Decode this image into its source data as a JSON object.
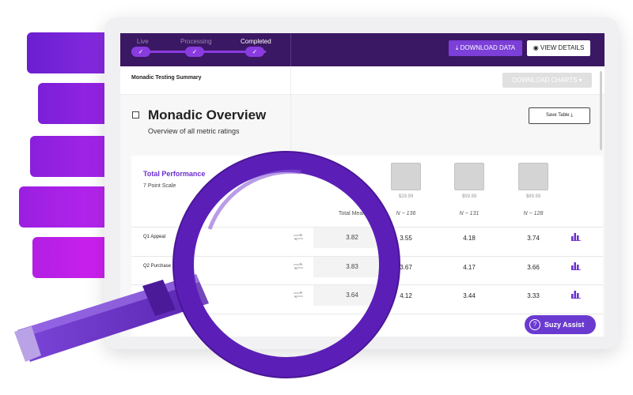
{
  "steps": [
    {
      "label": "Live",
      "done": false
    },
    {
      "label": "Processing",
      "done": false
    },
    {
      "label": "Completed",
      "done": true
    }
  ],
  "header": {
    "download_data": "DOWNLOAD DATA",
    "view_details": "VIEW DETAILS"
  },
  "subheader": {
    "title": "Monadic Testing Summary",
    "download_charts": "DOWNLOAD CHARTS"
  },
  "overview": {
    "title": "Monadic Overview",
    "subtitle": "Overview of all metric ratings",
    "save_table": "Save Table"
  },
  "performance": {
    "title": "Total Performance",
    "scale": "7 Point Scale",
    "total_mean_label": "Total Mean"
  },
  "products": [
    {
      "price": "$29.99",
      "n": "N ~ 136"
    },
    {
      "price": "$59.99",
      "n": "N ~ 131"
    },
    {
      "price": "$89.99",
      "n": "N ~ 128"
    }
  ],
  "rows": [
    {
      "label": "Q1 Appeal",
      "total": "3.82",
      "values": [
        "3.55",
        "4.18",
        "3.74"
      ]
    },
    {
      "label": "Q2 Purchase In",
      "total": "3.83",
      "values": [
        "3.67",
        "4.17",
        "3.66"
      ]
    },
    {
      "label": "",
      "total": "3.64",
      "values": [
        "4.12",
        "3.44",
        "3.33"
      ]
    }
  ],
  "assist": {
    "label": "Suzy Assist",
    "icon": "?"
  },
  "colors": {
    "header_bg": "#3b1863",
    "accent": "#7c3fd8",
    "title_accent": "#6a2fcf"
  }
}
